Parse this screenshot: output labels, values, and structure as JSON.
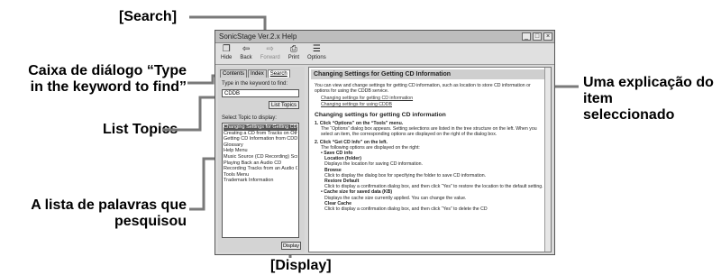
{
  "callouts": {
    "search": "[Search]",
    "dialog_line1": "Caixa de diálogo “Type",
    "dialog_line2": "in the keyword to find”",
    "list_topics": "List Topics",
    "list_words_line1": "A lista de palavras que",
    "list_words_line2": "pesquisou",
    "display": "[Display]",
    "explanation_line1": "Uma explicação do item",
    "explanation_line2": "seleccionado"
  },
  "window": {
    "title": "SonicStage Ver.2.x Help",
    "toolbar": [
      {
        "label": "Hide",
        "icon": "hide-icon",
        "glyph": "❐"
      },
      {
        "label": "Back",
        "icon": "back-icon",
        "glyph": "⇦"
      },
      {
        "label": "Forward",
        "icon": "forward-icon",
        "glyph": "⇨"
      },
      {
        "label": "Print",
        "icon": "print-icon",
        "glyph": "⎙"
      },
      {
        "label": "Options",
        "icon": "options-icon",
        "glyph": "☰"
      }
    ],
    "tabs": [
      "Contents",
      "Index",
      "Search"
    ],
    "keyword_label": "Type in the keyword to find:",
    "keyword_value": "CDDB",
    "list_topics_button": "List Topics",
    "select_topic_label": "Select Topic to display:",
    "topics": [
      "Changing Settings for Getting CD Information",
      "Creating a CD from Tracks on Other Audio ...",
      "Getting CD Information from CDDB",
      "Glossary",
      "Help Menu",
      "Music Source (CD Recording) Screen",
      "Playing Back an Audio CD",
      "Recording Tracks from an Audio CD",
      "Tools Menu",
      "Trademark Information"
    ],
    "display_button": "Display",
    "content": {
      "header": "Changing Settings for Getting CD Information",
      "intro": "You can view and change settings for getting CD information, such as location to store CD information or options for using the CDDB service.",
      "links": [
        "Changing settings for getting CD information",
        "Changing settings for using CDDB"
      ],
      "heading": "Changing settings for getting CD information",
      "step1": "1.  Click “Options” on the “Tools” menu.",
      "step1_text": "The “Options” dialog box appears. Setting selections are listed in the tree structure on the left. When you select an item, the corresponding options are displayed on the right of the dialog box.",
      "step2": "2.  Click “Get CD Info” on the left.",
      "step2_text": "The following options are displayed on the right:",
      "opt1": "•  Save CD info",
      "opt1_sub": "Location (folder)",
      "opt1_sub_text": "Displays the location for saving CD information.",
      "browse": "Browse",
      "browse_text": "Click to display the dialog box for specifying the folder to save CD information.",
      "restore": "Restore Default",
      "restore_text": "Click to display a confirmation dialog box, and then click “Yes” to restore the location to the default setting.",
      "opt2": "•  Cache size for saved data (KB)",
      "opt2_text": "Displays the cache size currently applied. You can change the value.",
      "clear": "Clear Cache",
      "clear_text": "Click to display a confirmation dialog box, and then click “Yes” to delete the CD"
    }
  }
}
